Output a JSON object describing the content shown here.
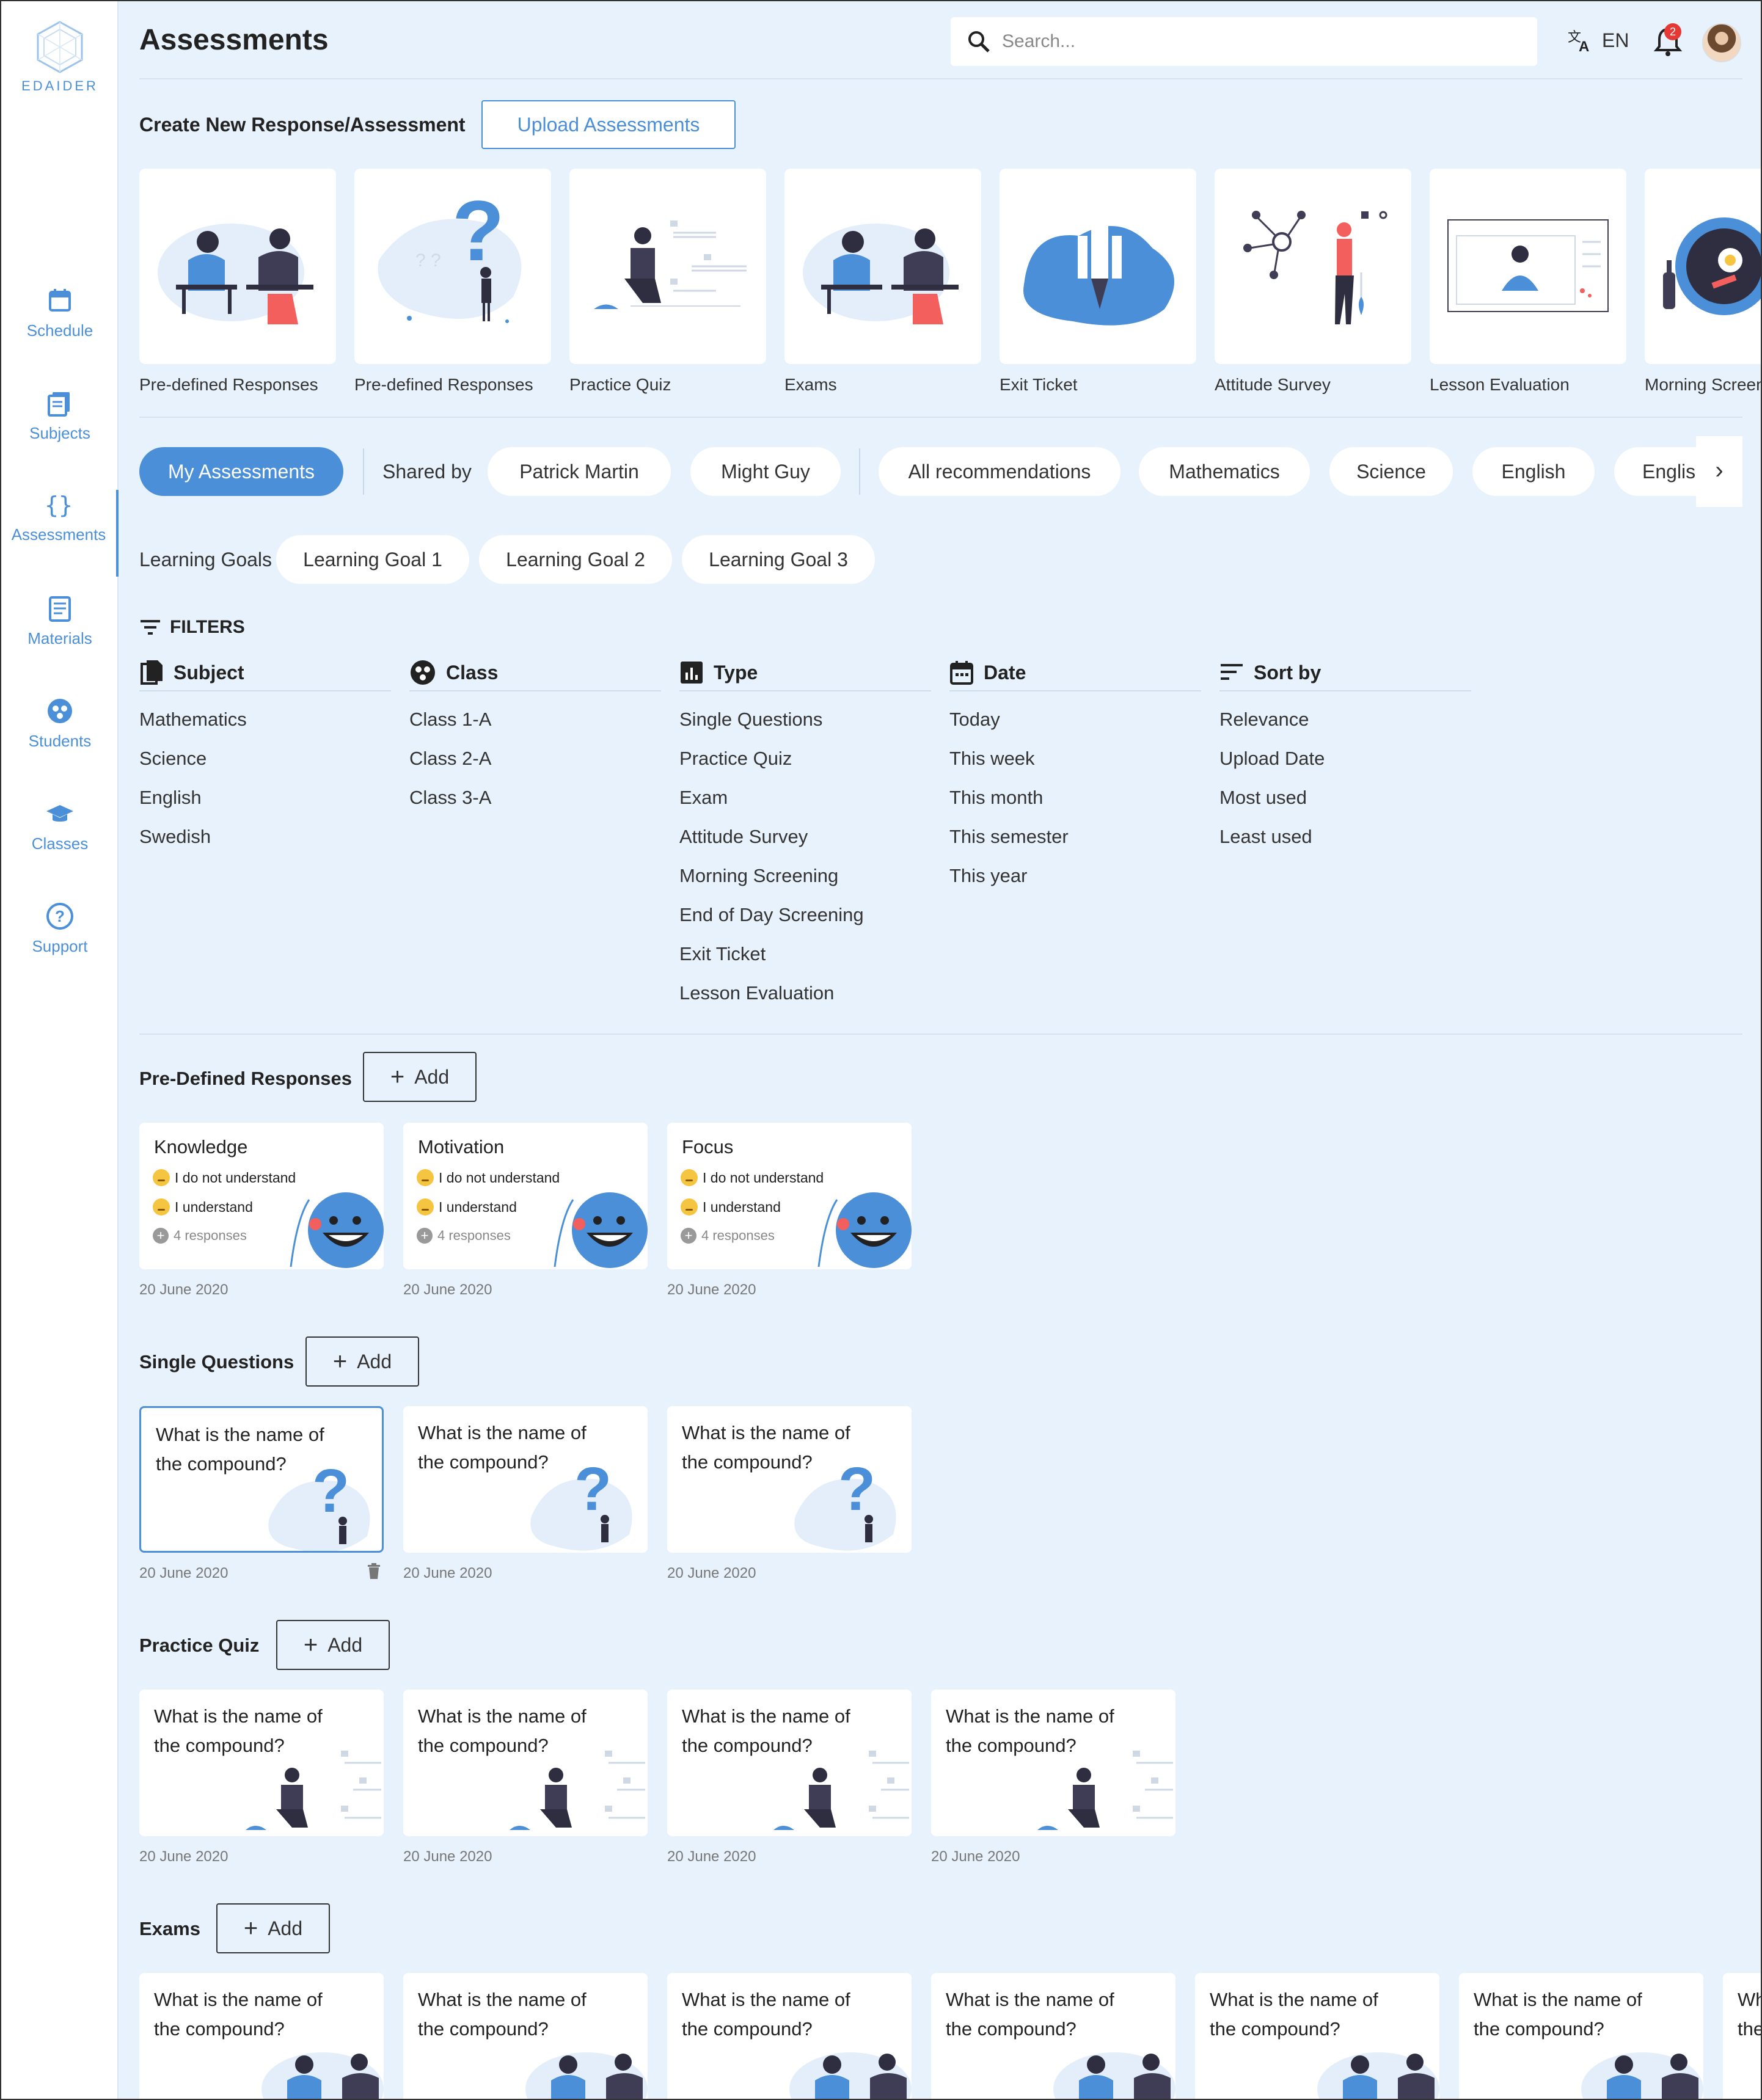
{
  "app": {
    "logo_text": "EDAIDER",
    "page_title": "Assessments"
  },
  "sidebar": {
    "items": [
      {
        "label": "Schedule",
        "icon": "calendar-icon"
      },
      {
        "label": "Subjects",
        "icon": "book-icon"
      },
      {
        "label": "Assessments",
        "icon": "braces-icon",
        "active": true
      },
      {
        "label": "Materials",
        "icon": "materials-icon"
      },
      {
        "label": "Students",
        "icon": "students-icon"
      },
      {
        "label": "Classes",
        "icon": "graduation-cap-icon"
      },
      {
        "label": "Support",
        "icon": "help-icon"
      }
    ]
  },
  "header": {
    "search_placeholder": "Search...",
    "language": "EN",
    "notification_count": "2"
  },
  "create": {
    "title": "Create New Response/Assessment",
    "upload_label": "Upload Assessments",
    "tiles": [
      "Pre-defined Responses",
      "Pre-defined Responses",
      "Practice Quiz",
      "Exams",
      "Exit Ticket",
      "Attitude Survey",
      "Lesson Evaluation",
      "Morning Screening"
    ]
  },
  "tabs": {
    "my_assessments": "My Assessments",
    "shared_by": "Shared by",
    "people": [
      "Patrick Martin",
      "Might Guy"
    ],
    "recommendations": [
      "All recommendations",
      "Mathematics",
      "Science",
      "English",
      "English"
    ]
  },
  "goals": {
    "label": "Learning Goals",
    "items": [
      "Learning Goal 1",
      "Learning Goal 2",
      "Learning Goal 3"
    ]
  },
  "filters": {
    "title": "FILTERS",
    "columns": [
      {
        "heading": "Subject",
        "icon": "file-copy-icon",
        "items": [
          "Mathematics",
          "Science",
          "English",
          "Swedish"
        ]
      },
      {
        "heading": "Class",
        "icon": "group-icon",
        "items": [
          "Class 1-A",
          "Class 2-A",
          "Class 3-A"
        ]
      },
      {
        "heading": "Type",
        "icon": "bar-chart-icon",
        "items": [
          "Single Questions",
          "Practice Quiz",
          "Exam",
          "Attitude Survey",
          "Morning Screening",
          "End of Day Screening",
          "Exit Ticket",
          "Lesson Evaluation"
        ]
      },
      {
        "heading": "Date",
        "icon": "calendar-icon",
        "items": [
          "Today",
          "This week",
          "This month",
          "This semester",
          "This year"
        ]
      },
      {
        "heading": "Sort by",
        "icon": "sort-icon",
        "items": [
          "Relevance",
          "Upload Date",
          "Most used",
          "Least used"
        ]
      }
    ]
  },
  "sections": {
    "add_label": "Add",
    "predefined": {
      "title": "Pre-Defined Responses",
      "cards": [
        {
          "title": "Knowledge",
          "line1": "I do not understand",
          "line2": "I understand",
          "count": "4 responses",
          "date": "20 June 2020"
        },
        {
          "title": "Motivation",
          "line1": "I do not understand",
          "line2": "I understand",
          "count": "4 responses",
          "date": "20 June 2020"
        },
        {
          "title": "Focus",
          "line1": "I do not understand",
          "line2": "I understand",
          "count": "4 responses",
          "date": "20 June 2020"
        }
      ]
    },
    "single": {
      "title": "Single Questions",
      "cards": [
        {
          "title": "What is the name of the compound?",
          "date": "20 June 2020"
        },
        {
          "title": "What is the name of the compound?",
          "date": "20 June 2020"
        },
        {
          "title": "What is the name of the compound?",
          "date": "20 June 2020"
        }
      ]
    },
    "practice": {
      "title": "Practice Quiz",
      "cards": [
        {
          "title": "What is the name of the compound?",
          "date": "20 June 2020"
        },
        {
          "title": "What is the name of the compound?",
          "date": "20 June 2020"
        },
        {
          "title": "What is the name of the compound?",
          "date": "20 June 2020"
        },
        {
          "title": "What is the name of the compound?",
          "date": "20 June 2020"
        }
      ]
    },
    "exams": {
      "title": "Exams",
      "cards": [
        {
          "title": "What is the name of the compound?"
        },
        {
          "title": "What is the name of the compound?"
        },
        {
          "title": "What is the name of the compound?"
        },
        {
          "title": "What is the name of the compound?"
        },
        {
          "title": "What is the name of the compound?"
        },
        {
          "title": "What is the name of the compound?"
        },
        {
          "title": "What is the name of the compound?"
        }
      ]
    }
  },
  "colors": {
    "accent": "#4a8fd8",
    "background": "#e8f2fc",
    "badge": "#e53935"
  }
}
